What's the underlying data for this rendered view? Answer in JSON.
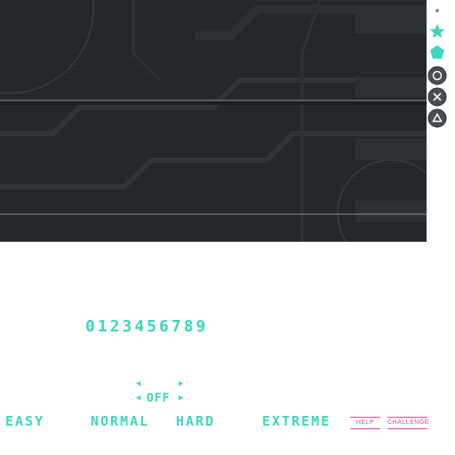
{
  "digits": "0123456789",
  "toggle": {
    "value": "OFF",
    "up_left": "◀",
    "up_right": "▶",
    "down_left": "◀",
    "down_right": "▶"
  },
  "difficulties": [
    "EASY",
    "NORMAL",
    "HARD",
    "EXTREME"
  ],
  "tags": [
    "HELP",
    "CHALLENGE"
  ],
  "icons": [
    "dot-icon",
    "star-icon",
    "pentagon-icon",
    "circle-button-icon",
    "cross-button-icon",
    "triangle-button-icon"
  ],
  "colors": {
    "accent_teal": "#3fd6bf",
    "accent_pink": "#d64a9a",
    "panel_bg": "#23272b",
    "button_gray": "#4a4d52"
  }
}
